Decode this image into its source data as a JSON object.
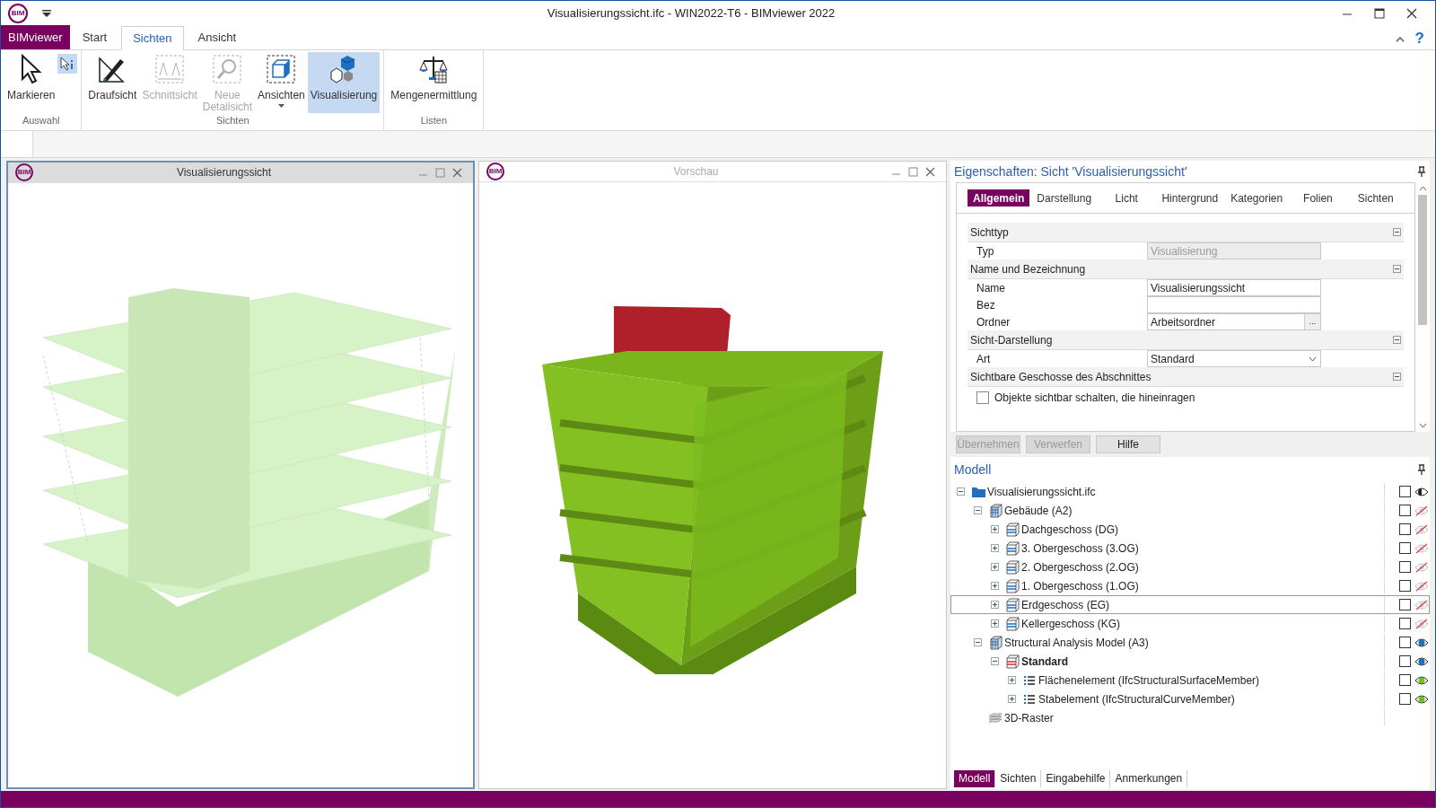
{
  "window": {
    "title": "Visualisierungssicht.ifc - WIN2022-T6 - BIMviewer 2022",
    "logo": "BIM",
    "help": "?"
  },
  "ribbon_tabs": [
    {
      "label": "BIMviewer",
      "kind": "app",
      "selected": false
    },
    {
      "label": "Start",
      "kind": "tab",
      "selected": false
    },
    {
      "label": "Sichten",
      "kind": "tab",
      "selected": true
    },
    {
      "label": "Ansicht",
      "kind": "tab",
      "selected": false
    }
  ],
  "ribbon_groups": [
    {
      "label": "Auswahl",
      "buttons": [
        {
          "label": "Markieren",
          "kind": "cursor",
          "disabled": false,
          "selected": false
        },
        {
          "kind": "info-cursor",
          "disabled": false,
          "selected": true
        }
      ]
    },
    {
      "label": "Sichten",
      "buttons": [
        {
          "label": "Draufsicht",
          "kind": "plan",
          "disabled": false,
          "selected": false
        },
        {
          "label": "Schnittsicht",
          "kind": "section",
          "disabled": true,
          "selected": false
        },
        {
          "label": "Neue Detailsicht",
          "kind": "detail",
          "disabled": true,
          "selected": false
        },
        {
          "label": "Ansichten",
          "kind": "cube",
          "disabled": false,
          "selected": false,
          "dropdown": true
        },
        {
          "label": "Visualisierung",
          "kind": "cubes",
          "disabled": false,
          "selected": true
        }
      ]
    },
    {
      "label": "Listen",
      "buttons": [
        {
          "label": "Mengenermittlung",
          "kind": "scale",
          "disabled": false,
          "selected": false
        }
      ]
    }
  ],
  "views": [
    {
      "title": "Visualisierungssicht",
      "logo": "BIM",
      "active": true,
      "kind": "transparent"
    },
    {
      "title": "Vorschau",
      "logo": "BIM",
      "active": false,
      "kind": "solid"
    }
  ],
  "properties": {
    "title": "Eigenschaften: Sicht 'Visualisierungssicht'",
    "tabs": [
      {
        "label": "Allgemein",
        "selected": true
      },
      {
        "label": "Darstellung",
        "selected": false
      },
      {
        "label": "Licht",
        "selected": false
      },
      {
        "label": "Hintergrund",
        "selected": false
      },
      {
        "label": "Kategorien",
        "selected": false
      },
      {
        "label": "Folien",
        "selected": false
      },
      {
        "label": "Sichten",
        "selected": false
      }
    ],
    "sections": [
      {
        "title": "Sichttyp",
        "rows": [
          {
            "kind": "text",
            "label": "Typ",
            "value": "Visualisierung",
            "disabled": true
          }
        ]
      },
      {
        "title": "Name und Bezeichnung",
        "rows": [
          {
            "kind": "text",
            "label": "Name",
            "value": "Visualisierungssicht",
            "disabled": false
          },
          {
            "kind": "text",
            "label": "Bez",
            "disabled": false
          },
          {
            "kind": "browse",
            "label": "Ordner",
            "value": "Arbeitsordner",
            "button": "...",
            "disabled": false
          }
        ]
      },
      {
        "title": "Sicht-Darstellung",
        "rows": [
          {
            "kind": "select",
            "label": "Art",
            "value": "Standard",
            "disabled": false
          }
        ]
      },
      {
        "title": "Sichtbare Geschosse des Abschnittes",
        "rows": [
          {
            "kind": "checkbox",
            "label": "Objekte sichtbar schalten, die hineinragen",
            "checked": false
          }
        ]
      }
    ],
    "buttons": [
      {
        "label": "Übernehmen",
        "disabled": true
      },
      {
        "label": "Verwerfen",
        "disabled": true
      },
      {
        "label": "Hilfe",
        "disabled": false
      }
    ]
  },
  "model": {
    "title": "Modell",
    "tree": [
      {
        "label": "Visualisierungssicht.ifc",
        "kind": "folder",
        "expanded": true,
        "checked": false,
        "visible": true,
        "partial": true,
        "selected": false,
        "children": [
          {
            "label": "Gebäude (A2)",
            "kind": "building",
            "expanded": true,
            "checked": false,
            "visible": false,
            "selected": false,
            "children": [
              {
                "label": "Dachgeschoss (DG)",
                "kind": "storey",
                "expanded": false,
                "checked": false,
                "visible": false,
                "selected": false
              },
              {
                "label": "3. Obergeschoss (3.OG)",
                "kind": "storey",
                "expanded": false,
                "checked": false,
                "visible": false,
                "selected": false
              },
              {
                "label": "2. Obergeschoss (2.OG)",
                "kind": "storey",
                "expanded": false,
                "checked": false,
                "visible": false,
                "selected": false
              },
              {
                "label": "1. Obergeschoss (1.OG)",
                "kind": "storey",
                "expanded": false,
                "checked": false,
                "visible": false,
                "selected": false
              },
              {
                "label": "Erdgeschoss (EG)",
                "kind": "storey",
                "expanded": false,
                "checked": false,
                "visible": false,
                "selected": true
              },
              {
                "label": "Kellergeschoss (KG)",
                "kind": "storey",
                "expanded": false,
                "checked": false,
                "visible": false,
                "selected": false
              }
            ]
          },
          {
            "label": "Structural Analysis Model (A3)",
            "kind": "building",
            "expanded": true,
            "checked": false,
            "visible": true,
            "color": "#1e6fc0",
            "selected": false,
            "children": [
              {
                "label": "Standard",
                "kind": "storey-active",
                "bold": true,
                "expanded": true,
                "checked": false,
                "visible": true,
                "color": "#1e6fc0",
                "selected": false,
                "children": [
                  {
                    "label": "Flächenelement (IfcStructuralSurfaceMember)",
                    "kind": "list",
                    "expanded": false,
                    "checked": false,
                    "visible": true,
                    "color": "#6cc21c",
                    "selected": false
                  },
                  {
                    "label": "Stabelement (IfcStructuralCurveMember)",
                    "kind": "list",
                    "expanded": false,
                    "checked": false,
                    "visible": true,
                    "color": "#6cc21c",
                    "selected": false
                  }
                ]
              }
            ]
          },
          {
            "label": "3D-Raster",
            "kind": "grid",
            "selected": false
          }
        ]
      }
    ]
  },
  "bottom_tabs": [
    {
      "label": "Modell",
      "selected": true
    },
    {
      "label": "Sichten",
      "selected": false
    },
    {
      "label": "Eingabehilfe",
      "selected": false
    },
    {
      "label": "Anmerkungen",
      "selected": false
    }
  ]
}
